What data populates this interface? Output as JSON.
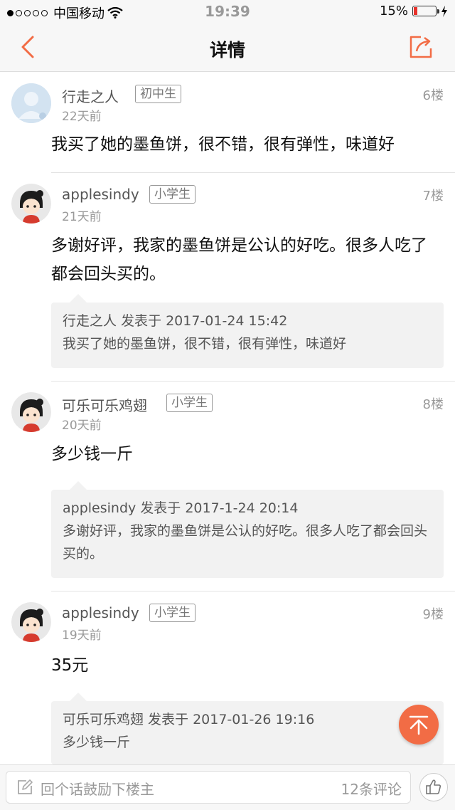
{
  "status_bar": {
    "carrier": "中国移动",
    "time": "19:39",
    "battery": "15%"
  },
  "nav": {
    "title": "详情"
  },
  "comments": [
    {
      "name": "行走之人",
      "badge": "初中生",
      "time": "22天前",
      "floor": "6楼",
      "content": "我买了她的墨鱼饼，很不错，很有弹性，味道好"
    },
    {
      "name": "applesindy",
      "badge": "小学生",
      "time": "21天前",
      "floor": "7楼",
      "content": "多谢好评，我家的墨鱼饼是公认的好吃。很多人吃了都会回头买的。",
      "quote": {
        "header": "行走之人 发表于 2017-01-24 15:42",
        "text": "我买了她的墨鱼饼，很不错，很有弹性，味道好"
      }
    },
    {
      "name": "可乐可乐鸡翅",
      "badge": "小学生",
      "time": "20天前",
      "floor": "8楼",
      "content": "多少钱一斤",
      "quote": {
        "header": "applesindy 发表于 2017-1-24 20:14",
        "text": "多谢好评，我家的墨鱼饼是公认的好吃。很多人吃了都会回头买的。"
      }
    },
    {
      "name": "applesindy",
      "badge": "小学生",
      "time": "19天前",
      "floor": "9楼",
      "content": "35元",
      "quote": {
        "header": "可乐可乐鸡翅 发表于 2017-01-26 19:16",
        "text": "多少钱一斤"
      }
    }
  ],
  "bottom_bar": {
    "placeholder": "回个话鼓励下楼主",
    "comment_count": "12条评论"
  },
  "colors": {
    "accent": "#f26c45"
  },
  "icons": [
    "back-icon",
    "share-icon",
    "wifi-icon",
    "top-icon",
    "pen-icon",
    "thumbs-up-icon"
  ]
}
